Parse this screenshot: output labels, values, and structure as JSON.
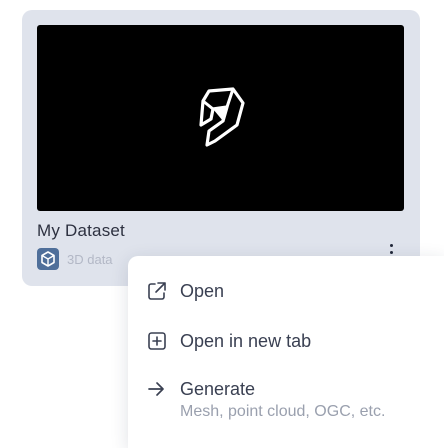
{
  "card": {
    "title": "My Dataset",
    "type_label": "3D data"
  },
  "menu": {
    "items": [
      {
        "label": "Open",
        "icon": "open-external-icon"
      },
      {
        "label": "Open in new tab",
        "icon": "new-tab-icon"
      },
      {
        "label": "Generate",
        "sublabel": "Mesh, point cloud, OGC, etc.",
        "icon": "arrow-right-icon"
      }
    ]
  },
  "colors": {
    "card_bg": "#dfe3ec",
    "thumbnail_bg": "#000000",
    "type_badge": "#4f6f9a",
    "menu_bg": "#ffffff"
  }
}
